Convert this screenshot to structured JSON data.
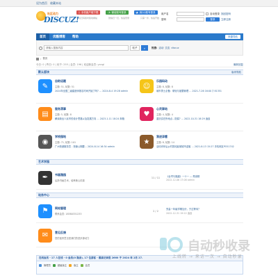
{
  "topbar": {
    "links": [
      "设为首页",
      "收藏本站"
    ]
  },
  "header": {
    "logo_slogan": "社区动力",
    "logo_word": "DISCUZ!",
    "promo": [
      {
        "label": "手机客户端下载",
        "sub": "手机扫码随时随地看帖",
        "color": "#d9534f"
      },
      {
        "label": "微信账号登录",
        "sub": "微信扫一扫，快速登录",
        "color": "#43a047"
      },
      {
        "label": "用QQ账号登录",
        "sub": "只需一步，快速开始",
        "color": "#2e7bd6"
      }
    ]
  },
  "login": {
    "user_label": "用户名",
    "user_placeholder": "",
    "pass_label": "密码",
    "auto_login": "自动登录",
    "forgot": "找回密码",
    "login_btn": "登录",
    "register": "立即注册"
  },
  "nav": {
    "items": [
      "首页",
      "优酷博客",
      "帮助"
    ],
    "quick": "快捷导航"
  },
  "search": {
    "placeholder": "请输入搜索内容",
    "scope": "帖子",
    "hot_label": "热搜:",
    "hot_words": [
      "活动",
      "交友",
      "discuz"
    ]
  },
  "breadcrumb": {
    "items": [
      "首页"
    ]
  },
  "stats": {
    "text": "今日: 0 | 昨日: 0 | 帖子: 255 | 会员: 196 | 欢迎新会员: yangl",
    "latest": "最新回复"
  },
  "categories": [
    {
      "title": "默认版块",
      "toggle": "版块导航",
      "forums": [
        {
          "name": "自助话题",
          "counts": "主题: 51, 帖数: 51",
          "last": "2024年全国二级建造师报名时间开始了吗? … 2024-8-4 19:28 admin",
          "icon_color": "#1e90ff",
          "glyph": "✎"
        },
        {
          "name": "乐园码动",
          "counts": "主题: 8, 帖数: 8",
          "last": "城市男士必备：硬化与被要管理 … 2021-7-26 16:00 扌81351",
          "icon_color": "#f5c518",
          "glyph": "☺"
        },
        {
          "name": "服务洞事",
          "counts": "主题: 5, 帖数: 8",
          "last": "解读新出人民币的设计思路以及发展方向 … 2023-1-11 18:24 奔跑",
          "icon_color": "#ff8c1a",
          "glyph": "▤"
        },
        {
          "name": "心灵驿站",
          "counts": "主题: 4, 帖数: 4",
          "last": "重庆实在所地点...防腐? … 2022-10-31 18:29 逍遥",
          "icon_color": "#e0245e",
          "glyph": "♥"
        },
        {
          "name": "学校园地",
          "counts": "主题: 71, 帖数: 101",
          "last": "广州快递服务员 - 快速公期要... 2024-8-14 16:34 admin",
          "icon_color": "#555555",
          "glyph": "◉"
        },
        {
          "name": "我进添看",
          "counts": "主题: 8, 帖数: 14",
          "last": "活动青年后乡村振动起城城市迎客 … 2021-8-13 15:27 手机网友PO51742",
          "icon_color": "#8b5a2b",
          "glyph": "★"
        }
      ]
    },
    {
      "title": "艺术学园",
      "toggle": "",
      "forums": [
        {
          "name": "书画雅园",
          "counts": "弘扬书画艺术，培养美心情操",
          "reply_counts": "11 / 11",
          "last_title": "《台湾与福建》一十一 — 再减辑",
          "last_when": "2022-12-06 17:08 admin",
          "icon_color": "#333333",
          "glyph": "✒"
        }
      ]
    },
    {
      "title": "站务中心",
      "toggle": "",
      "forums": [
        {
          "name": "网站管理",
          "counts": "联系会员: 18380331233",
          "reply_counts": "2 / 2",
          "last_title": "完善一年级学期加分，只过等待？",
          "last_when": "2022-12-31 19:22 逍遥",
          "icon_color": "#1e90ff",
          "glyph": "⚑"
        },
        {
          "name": "意见反馈",
          "counts": "您的宝贵意见是我们的进步源动力",
          "reply_counts": "",
          "last_title": "",
          "last_when": "",
          "icon_color": "#ff8c1a",
          "glyph": "✉"
        }
      ]
    }
  ],
  "online": {
    "head": "在线会员 - 17 人在线 - 0 会员(0 隐身), 17 位游客 - 最高记录是 2660 于 2024 年 2月 27.",
    "legend": [
      {
        "label": "管理员",
        "color": "#4a90d9"
      },
      {
        "label": "超级版主",
        "color": "#43a047"
      },
      {
        "label": "版主",
        "color": "#f5a623"
      },
      {
        "label": "会员",
        "color": "#7ab648"
      }
    ]
  },
  "watermark": {
    "brand": "自动秒收录",
    "slogan": "上线转 → 来访一次 → 自动秒录"
  }
}
